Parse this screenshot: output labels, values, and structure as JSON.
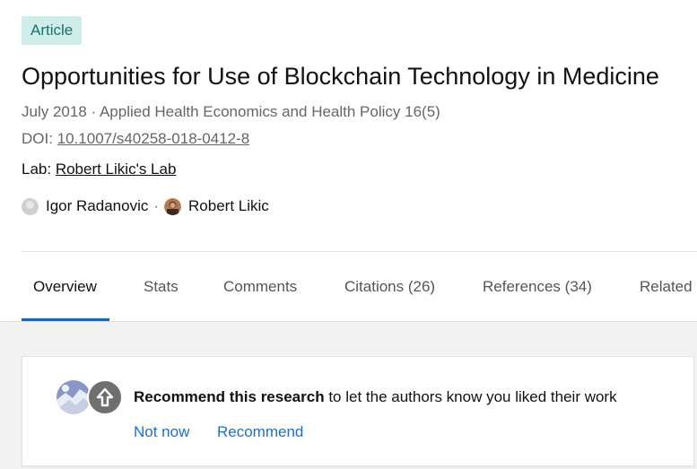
{
  "article": {
    "badge": "Article",
    "title": "Opportunities for Use of Blockchain Technology in Medicine",
    "meta": "July 2018 · Applied Health Economics and Health Policy 16(5)",
    "doi_label": "DOI: ",
    "doi_value": "10.1007/s40258-018-0412-8",
    "lab_label": "Lab: ",
    "lab_value": "Robert Likic's Lab",
    "authors": [
      {
        "name": "Igor Radanovic",
        "avatar": "default-avatar-icon"
      },
      {
        "name": "Robert Likic",
        "avatar": "profile-photo"
      }
    ],
    "author_separator": "·"
  },
  "tabs": [
    {
      "label": "Overview",
      "active": true
    },
    {
      "label": "Stats",
      "active": false
    },
    {
      "label": "Comments",
      "active": false
    },
    {
      "label": "Citations (26)",
      "active": false
    },
    {
      "label": "References (34)",
      "active": false
    },
    {
      "label": "Related",
      "active": false
    }
  ],
  "recommend": {
    "bold_text": "Recommend this research",
    "rest_text": " to let the authors know you liked their work",
    "not_now_label": "Not now",
    "recommend_label": "Recommend",
    "icon": "upvote-arrow-icon"
  },
  "colors": {
    "badge_bg": "#cfeee9",
    "badge_text": "#17736b",
    "accent": "#0a66d6",
    "link": "#1a6fd6"
  }
}
